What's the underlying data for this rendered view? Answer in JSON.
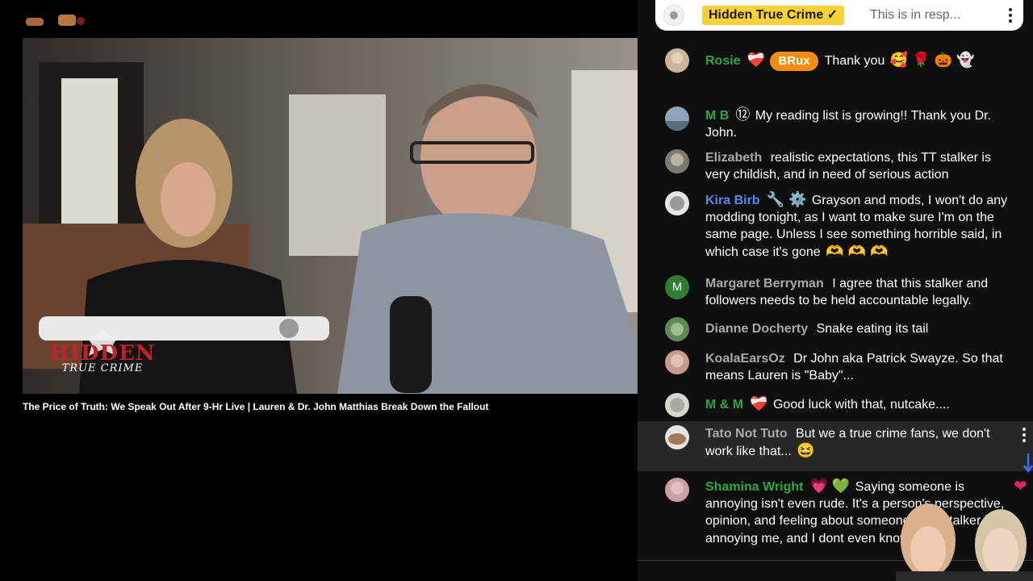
{
  "video": {
    "watermark_top": "HIDDEN",
    "watermark_bottom": "TRUE CRIME",
    "title": "The Price of Truth: We Speak Out After 9-Hr Live | Lauren & Dr. John Matthias Break Down the Fallout"
  },
  "chat": {
    "pinned": {
      "author": "Hidden True Crime ✓",
      "text": "This is in resp..."
    },
    "messages": [
      {
        "author": "Rosie",
        "badge": "BRux",
        "text": "Thank you",
        "emoji": "🥰 🌹 🎃 👻",
        "author_emoji": "❤️‍🩹"
      },
      {
        "author": "M B",
        "author_emoji": "⑫",
        "text": "My reading list is growing!! Thank you Dr. John."
      },
      {
        "author": "Elizabeth",
        "text": "realistic expectations, this TT stalker is very childish, and in need of serious action"
      },
      {
        "author": "Kira Birb",
        "author_emoji": "🔧 ⚙️",
        "text": "Grayson and mods, I won't do any modding tonight, as I want to make sure I'm on the same page. Unless I see something horrible said, in which case it's gone",
        "emoji": "🫶 🫶 🫶"
      },
      {
        "author": "Margaret Berryman",
        "avatar_letter": "M",
        "text": "I agree that this stalker and followers needs to be held accountable legally."
      },
      {
        "author": "Dianne Docherty",
        "text": "Snake eating its tail"
      },
      {
        "author": "KoalaEarsOz",
        "text": "Dr John aka Patrick Swayze. So that means Lauren is \"Baby\"..."
      },
      {
        "author": "M & M",
        "author_emoji": "❤️‍🩹",
        "text": "Good luck with that, nutcake...."
      },
      {
        "author": "Tato Not Tuto",
        "text": "But we a true crime fans, we don't work like that...",
        "emoji": "😆"
      },
      {
        "author": "Shamina Wright",
        "author_emoji": "💗 💚",
        "text": "Saying someone is annoying isn't even rude. It's a person's perspective, opinion, and feeling about someone. The stalker is annoying me, and I dont even know",
        "emoji": "😣"
      }
    ]
  },
  "colors": {
    "pinned_badge": "#f6d238",
    "member_green": "#2ba640",
    "moderator_blue": "#5e84f1",
    "chat_bg": "#0f0f0f",
    "badge_orange": "#f28c13"
  }
}
